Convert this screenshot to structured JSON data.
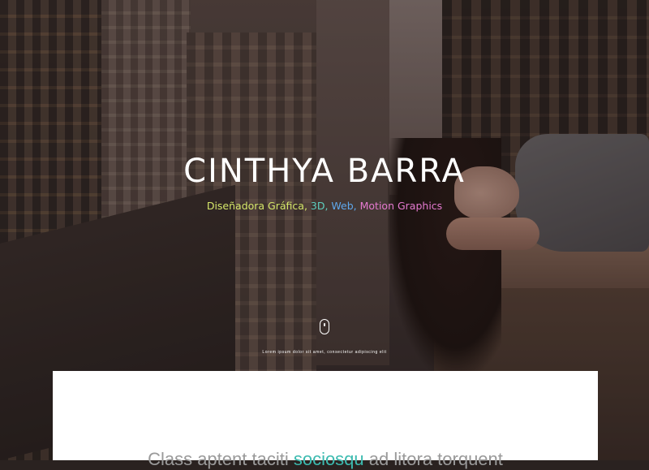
{
  "hero": {
    "title": "CINTHYA BARRA",
    "subtitle_parts": [
      {
        "text": "Diseñadora Gráfica,",
        "color": "#d6e86a"
      },
      {
        "text": " 3D,",
        "color": "#5fd0c0"
      },
      {
        "text": " Web,",
        "color": "#5fa9ee"
      },
      {
        "text": " Motion Graphics",
        "color": "#e57ad0"
      }
    ],
    "scroll_icon": "mouse-scroll-icon",
    "scroll_text": "Lorem ipsum dolor sit amet, consectetur adipiscing elit"
  },
  "intro": {
    "tagline_before": "Class aptent taciti ",
    "tagline_highlight": "sociosqu",
    "tagline_after": " ad litora torquent",
    "highlight_color": "#3dbbb0"
  }
}
